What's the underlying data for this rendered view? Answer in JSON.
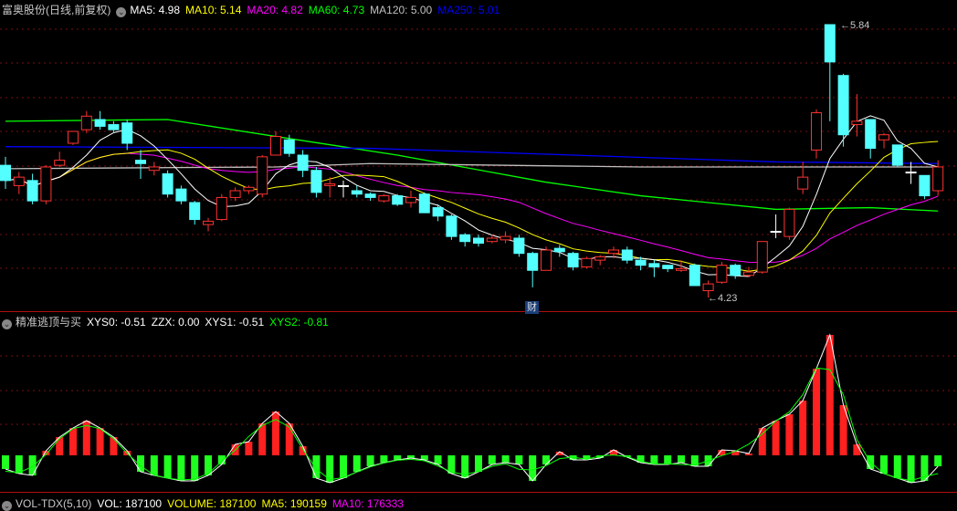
{
  "main_header": {
    "title": "富奥股份(日线,前复权)",
    "ma": [
      {
        "label": "MA5: 4.98",
        "color": "#ffffff"
      },
      {
        "label": "MA10: 5.14",
        "color": "#ffff00"
      },
      {
        "label": "MA20: 4.82",
        "color": "#ff00ff"
      },
      {
        "label": "MA60: 4.73",
        "color": "#00ff00"
      },
      {
        "label": "MA120: 5.00",
        "color": "#c0c0c0"
      },
      {
        "label": "MA250: 5.01",
        "color": "#0000ff"
      }
    ]
  },
  "annotations": {
    "high": "5.84",
    "low": "4.23",
    "event_badge": "财"
  },
  "indicator_header": {
    "title": "精准逃顶与买",
    "items": [
      {
        "label": "XYS0: -0.51",
        "color": "#ffffff"
      },
      {
        "label": "ZZX: 0.00",
        "color": "#ffffff"
      },
      {
        "label": "XYS1: -0.51",
        "color": "#ffffff"
      },
      {
        "label": "XYS2: -0.81",
        "color": "#00ff00"
      }
    ]
  },
  "volume_header": {
    "items": [
      {
        "label": "VOL-TDX(5,10)",
        "color": "#c8c8c8"
      },
      {
        "label": "VOL: 187100",
        "color": "#ffffff"
      },
      {
        "label": "VOLUME: 187100",
        "color": "#ffff00"
      },
      {
        "label": "MA5: 190159",
        "color": "#ffff00"
      },
      {
        "label": "MA10: 176333",
        "color": "#ff00ff"
      }
    ]
  },
  "chart_data": [
    {
      "type": "candlestick",
      "title": "富奥股份(日线,前复权)",
      "ylim": [
        4.15,
        5.9
      ],
      "up_color": "#ff3232",
      "down_color": "#54ffff",
      "ohlc": [
        [
          5.01,
          5.06,
          4.87,
          4.92
        ],
        [
          4.89,
          4.97,
          4.84,
          4.94
        ],
        [
          4.92,
          4.96,
          4.78,
          4.8
        ],
        [
          4.8,
          5.01,
          4.78,
          5.0
        ],
        [
          5.01,
          5.09,
          5.0,
          5.04
        ],
        [
          5.14,
          5.21,
          5.13,
          5.21
        ],
        [
          5.22,
          5.33,
          5.2,
          5.3
        ],
        [
          5.28,
          5.33,
          5.22,
          5.24
        ],
        [
          5.25,
          5.27,
          5.2,
          5.22
        ],
        [
          5.26,
          5.28,
          5.1,
          5.14
        ],
        [
          5.04,
          5.1,
          4.93,
          5.02
        ],
        [
          4.98,
          5.03,
          4.95,
          5.0
        ],
        [
          4.96,
          4.98,
          4.82,
          4.84
        ],
        [
          4.87,
          4.89,
          4.78,
          4.8
        ],
        [
          4.79,
          4.8,
          4.66,
          4.69
        ],
        [
          4.66,
          4.7,
          4.62,
          4.68
        ],
        [
          4.69,
          4.84,
          4.68,
          4.82
        ],
        [
          4.82,
          4.88,
          4.8,
          4.86
        ],
        [
          4.86,
          4.89,
          4.84,
          4.88
        ],
        [
          4.84,
          5.07,
          4.82,
          5.06
        ],
        [
          5.07,
          5.21,
          5.07,
          5.18
        ],
        [
          5.16,
          5.19,
          5.06,
          5.08
        ],
        [
          5.07,
          5.1,
          4.94,
          4.98
        ],
        [
          4.98,
          5.0,
          4.82,
          4.85
        ],
        [
          4.89,
          4.94,
          4.82,
          4.9
        ],
        [
          4.89,
          4.92,
          4.82,
          4.89
        ],
        [
          4.86,
          4.89,
          4.82,
          4.84
        ],
        [
          4.84,
          4.85,
          4.8,
          4.82
        ],
        [
          4.8,
          4.84,
          4.79,
          4.83
        ],
        [
          4.83,
          4.84,
          4.77,
          4.78
        ],
        [
          4.79,
          4.86,
          4.76,
          4.82
        ],
        [
          4.84,
          4.85,
          4.73,
          4.73
        ],
        [
          4.76,
          4.78,
          4.68,
          4.71
        ],
        [
          4.71,
          4.72,
          4.57,
          4.59
        ],
        [
          4.6,
          4.61,
          4.53,
          4.56
        ],
        [
          4.58,
          4.6,
          4.53,
          4.55
        ],
        [
          4.56,
          4.6,
          4.55,
          4.58
        ],
        [
          4.57,
          4.62,
          4.55,
          4.59
        ],
        [
          4.58,
          4.6,
          4.47,
          4.49
        ],
        [
          4.49,
          4.5,
          4.29,
          4.39
        ],
        [
          4.39,
          4.53,
          4.39,
          4.51
        ],
        [
          4.52,
          4.54,
          4.47,
          4.5
        ],
        [
          4.49,
          4.5,
          4.39,
          4.41
        ],
        [
          4.41,
          4.47,
          4.4,
          4.46
        ],
        [
          4.45,
          4.48,
          4.42,
          4.47
        ],
        [
          4.49,
          4.53,
          4.46,
          4.51
        ],
        [
          4.51,
          4.53,
          4.43,
          4.45
        ],
        [
          4.45,
          4.47,
          4.39,
          4.42
        ],
        [
          4.43,
          4.45,
          4.35,
          4.41
        ],
        [
          4.42,
          4.42,
          4.38,
          4.4
        ],
        [
          4.39,
          4.45,
          4.38,
          4.4
        ],
        [
          4.42,
          4.43,
          4.3,
          4.3
        ],
        [
          4.27,
          4.33,
          4.23,
          4.31
        ],
        [
          4.32,
          4.44,
          4.31,
          4.42
        ],
        [
          4.42,
          4.43,
          4.34,
          4.36
        ],
        [
          4.36,
          4.41,
          4.35,
          4.38
        ],
        [
          4.38,
          4.56,
          4.37,
          4.56
        ],
        [
          4.62,
          4.72,
          4.58,
          4.62
        ],
        [
          4.59,
          4.76,
          4.57,
          4.75
        ],
        [
          4.87,
          5.03,
          4.84,
          4.94
        ],
        [
          5.1,
          5.34,
          5.05,
          5.32
        ],
        [
          5.84,
          5.84,
          5.27,
          5.62
        ],
        [
          5.54,
          5.55,
          5.12,
          5.19
        ],
        [
          5.25,
          5.43,
          5.18,
          5.27
        ],
        [
          5.28,
          5.28,
          5.05,
          5.11
        ],
        [
          5.16,
          5.2,
          5.11,
          5.19
        ],
        [
          5.13,
          5.13,
          5.0,
          5.01
        ],
        [
          4.97,
          5.03,
          4.9,
          4.97
        ],
        [
          4.95,
          4.95,
          4.81,
          4.83
        ],
        [
          4.86,
          5.04,
          4.83,
          5.0
        ]
      ],
      "ma60": [
        [
          0,
          5.27
        ],
        [
          12,
          5.28
        ],
        [
          20,
          5.18
        ],
        [
          29,
          5.07
        ],
        [
          40,
          4.91
        ],
        [
          47,
          4.83
        ],
        [
          57,
          4.75
        ],
        [
          64,
          4.76
        ],
        [
          69,
          4.74
        ]
      ],
      "ma120": [
        [
          0,
          4.99
        ],
        [
          20,
          5.0
        ],
        [
          27,
          5.02
        ],
        [
          47,
          5.0
        ],
        [
          69,
          5.0
        ]
      ],
      "ma250": [
        [
          0,
          5.12
        ],
        [
          27,
          5.11
        ],
        [
          57,
          5.03
        ],
        [
          69,
          5.02
        ]
      ]
    },
    {
      "type": "bar",
      "title": "精准逃顶与买",
      "ylim": [
        -0.4,
        1.4
      ],
      "values": [
        -0.15,
        -0.2,
        -0.22,
        0.05,
        0.2,
        0.3,
        0.38,
        0.3,
        0.2,
        0.05,
        -0.18,
        -0.22,
        -0.25,
        -0.28,
        -0.28,
        -0.22,
        -0.1,
        0.12,
        0.15,
        0.35,
        0.48,
        0.35,
        0.1,
        -0.25,
        -0.3,
        -0.25,
        -0.18,
        -0.12,
        -0.08,
        -0.05,
        -0.03,
        -0.05,
        -0.1,
        -0.2,
        -0.25,
        -0.18,
        -0.1,
        -0.08,
        -0.1,
        -0.28,
        -0.1,
        0.04,
        -0.05,
        -0.05,
        -0.03,
        0.06,
        -0.02,
        -0.08,
        -0.1,
        -0.1,
        -0.08,
        -0.12,
        -0.12,
        0.06,
        0.05,
        0.02,
        0.3,
        0.38,
        0.45,
        0.6,
        0.95,
        1.32,
        0.55,
        0.12,
        -0.15,
        -0.2,
        -0.25,
        -0.3,
        -0.28,
        -0.12
      ]
    }
  ]
}
